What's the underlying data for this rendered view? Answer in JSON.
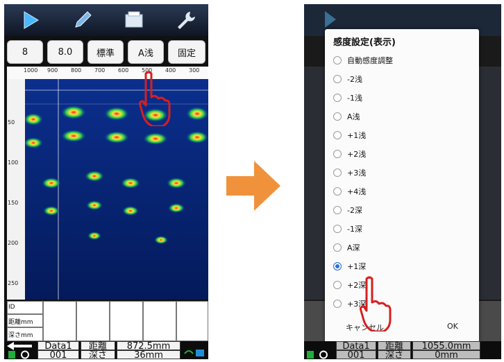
{
  "left": {
    "controls": [
      "8",
      "8.0",
      "標準",
      "A浅",
      "固定"
    ],
    "ruler_ticks": [
      "1000",
      "900",
      "800",
      "700",
      "600",
      "500",
      "400",
      "300"
    ],
    "depth_ticks": [
      "50",
      "100",
      "150",
      "200",
      "250"
    ],
    "table_labels": [
      "ID",
      "距離mm",
      "深さmm"
    ],
    "bottom": {
      "name": "Data1",
      "id": "001",
      "label_distance": "距離",
      "label_depth": "深さ",
      "distance_value": "872.5mm",
      "depth_value": "36mm"
    }
  },
  "dialog": {
    "title": "感度設定(表示)",
    "options": [
      "自動感度調整",
      "-2浅",
      "-1浅",
      "A浅",
      "+1浅",
      "+2浅",
      "+3浅",
      "+4浅",
      "-2深",
      "-1深",
      "A深",
      "+1深",
      "+2深",
      "+3深"
    ],
    "selected_index": 11,
    "cancel_label": "キャンセル",
    "ok_label": "OK"
  },
  "right": {
    "bottom": {
      "name": "Data1",
      "id": "001",
      "label_distance": "距離",
      "label_depth": "深さ",
      "distance_value": "1055.0mm",
      "depth_value": "0mm"
    }
  },
  "colors": {
    "accent": "#2b6fd8",
    "arrow": "#f0923c",
    "hand": "#d81f1f"
  }
}
